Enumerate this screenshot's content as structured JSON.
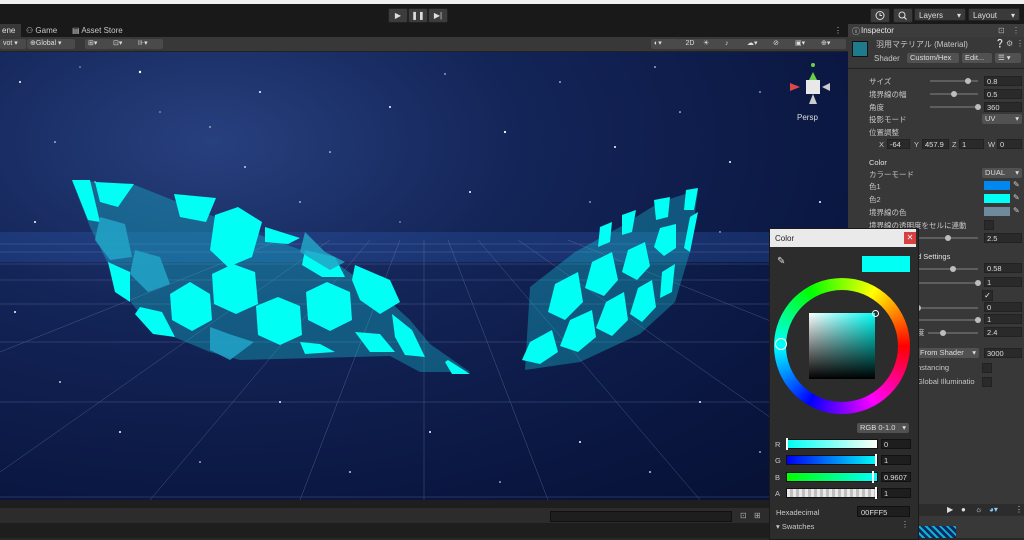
{
  "toolbar": {
    "play_icon": "▶",
    "pause_icon": "❚❚",
    "step_icon": "▶|",
    "history_icon": "history-icon",
    "search_icon": "search-icon",
    "layers_label": "Layers",
    "layout_label": "Layout"
  },
  "tabs": {
    "scene": "ene",
    "game": "Game",
    "asset_store": "Asset Store"
  },
  "scene_toolbar": {
    "pivot": "vot",
    "global": "Global",
    "mode_2d": "2D",
    "persp": "Persp"
  },
  "inspector": {
    "tab_label": "Inspector",
    "material_name": "羽用マテリアル (Material)",
    "shader_label": "Shader",
    "shader_value": "Custom/Hex",
    "edit_button": "Edit...",
    "rows": {
      "size_label": "サイズ",
      "size_value": "0.8",
      "size_level": 0.8,
      "border_width_label": "境界線の幅",
      "border_width_value": "0.5",
      "border_width_level": 0.5,
      "angle_label": "角度",
      "angle_value": "360",
      "angle_level": 1.0,
      "projection_label": "投影モード",
      "projection_value": "UV",
      "position_label": "位置調整",
      "pos_x_label": "X",
      "pos_x": "-64",
      "pos_y_label": "Y",
      "pos_y": "457.9",
      "pos_z_label": "Z",
      "pos_z": "1",
      "pos_w_label": "W",
      "pos_w": "0"
    },
    "color_section": {
      "header": "Color",
      "color_mode_label": "カラーモード",
      "color_mode_value": "DUAL",
      "color1_label": "色1",
      "color1_hex": "#0088f0",
      "color2_label": "色2",
      "color2_hex": "#00fff5",
      "border_color_label": "境界線の色",
      "border_color_hex": "#6e8a9c",
      "link_label": "境界線の透明度をセルに連動",
      "link_value": "2.5",
      "link_level": 0.5
    },
    "advanced": {
      "header_partial": "d Settings",
      "val1": "0.58",
      "val1_level": 0.58,
      "val2": "1",
      "val2_level": 1.0,
      "val3": "0",
      "val3_level": 0.0,
      "val4": "1",
      "val4_level": 1.0,
      "val5_label_partial": "度",
      "val5": "2.4",
      "val5_level": 0.3,
      "render_queue_mode": "From Shader",
      "render_queue": "3000",
      "instancing_label": "nstancing",
      "gi_label": "Global Illuminatio"
    }
  },
  "color_picker": {
    "title": "Color",
    "close_icon": "✕",
    "current_color": "#00fff5",
    "mode": "RGB 0-1.0",
    "r_label": "R",
    "r_value": "0",
    "r_level": 0.0,
    "g_label": "G",
    "g_value": "1",
    "g_level": 1.0,
    "b_label": "B",
    "b_value": "0.9607",
    "b_level": 0.9607,
    "a_label": "A",
    "a_value": "1",
    "a_level": 1.0,
    "hex_label": "Hexadecimal",
    "hex_value": "00FFF5",
    "swatches_label": "Swatches"
  },
  "colors": {
    "accent_blue": "#2d6bd0",
    "hex_cyan": "#00fff5",
    "editor_dark": "#282828"
  }
}
